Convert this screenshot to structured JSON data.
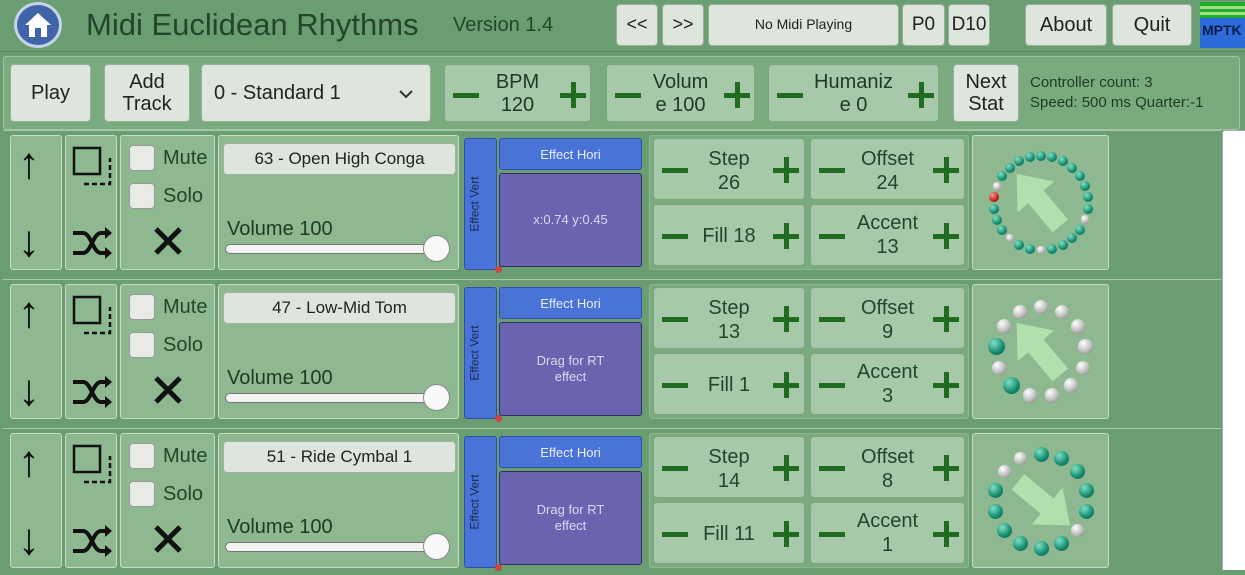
{
  "header": {
    "title": "Midi Euclidean Rhythms",
    "version": "Version 1.4",
    "prev_label": "<<",
    "next_label": ">>",
    "status": "No Midi Playing",
    "p_label": "P0",
    "d_label": "D10",
    "about_label": "About",
    "quit_label": "Quit",
    "logo_text": "MPTK"
  },
  "controls": {
    "play_label": "Play",
    "add_track_label": "Add Track",
    "preset_value": "0 - Standard 1",
    "bpm_label": "BPM",
    "bpm_value": "120",
    "volume_line1": "Volum",
    "volume_line2": "e 100",
    "humanize_line1": "Humaniz",
    "humanize_line2": "e 0",
    "next_stat_label": "Next Stat",
    "controller_count": "Controller count: 3",
    "speed_text": "Speed: 500 ms Quarter:-1"
  },
  "labels": {
    "mute": "Mute",
    "solo": "Solo",
    "effect_vert": "Effect Vert",
    "effect_hori": "Effect Hori",
    "step": "Step",
    "offset": "Offset",
    "accent": "Accent"
  },
  "tracks": [
    {
      "instrument": "63 - Open High Conga",
      "volume_label": "Volume 100",
      "volume": 100,
      "effect_pad": "x:0.74 y:0.45",
      "step": "26",
      "offset": "24",
      "fill": "Fill 18",
      "accent": "13"
    },
    {
      "instrument": "47 - Low-Mid Tom",
      "volume_label": "Volume 100",
      "volume": 100,
      "effect_pad": "Drag for RT effect",
      "step": "13",
      "offset": "9",
      "fill": "Fill 1",
      "accent": "3"
    },
    {
      "instrument": "51 - Ride Cymbal 1",
      "volume_label": "Volume 100",
      "volume": 100,
      "effect_pad": "Drag for RT effect",
      "step": "14",
      "offset": "8",
      "fill": "Fill 11",
      "accent": "1"
    }
  ],
  "colors": {
    "background": "#6a9e72",
    "panel": "#8db890",
    "plus_minus": "#1f6b1f",
    "effect_blue": "#4a73d8",
    "effect_pad": "#6b62b0",
    "bead_teal": "#13896e",
    "bead_grey": "#b7b7b7"
  },
  "icons": [
    "home-icon",
    "arrow-up-icon",
    "arrow-down-icon",
    "select-icon",
    "shuffle-icon",
    "close-icon",
    "chevron-down-icon",
    "play-direction-arrow-icon"
  ]
}
